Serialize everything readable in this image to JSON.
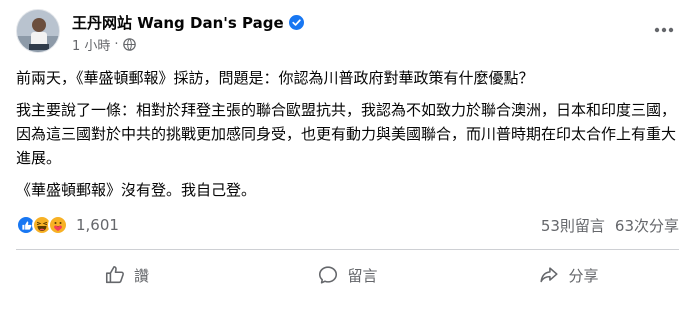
{
  "post": {
    "page_name": "王丹网站 Wang Dan's Page",
    "timestamp": "1 小時",
    "dot": "·",
    "paragraphs": [
      "前兩天，《華盛頓郵報》採訪，問題是：你認為川普政府對華政策有什麼優點？",
      "我主要說了一條：相對於拜登主張的聯合歐盟抗共，我認為不如致力於聯合澳洲，日本和印度三國，因為這三國對於中共的挑戰更加感同身受，也更有動力與美國聯合，而川普時期在印太合作上有重大進展。",
      "《華盛頓郵報》沒有登。我自己登。"
    ],
    "reaction_icons": [
      "like-icon",
      "haha-icon",
      "care-icon"
    ],
    "reaction_count": "1,601",
    "comments_count": "53則留言",
    "shares_count": "63次分享"
  },
  "actions": {
    "like_label": "讚",
    "comment_label": "留言",
    "share_label": "分享"
  },
  "colors": {
    "verified": "#1877f2",
    "secondary_text": "#65676b",
    "like": "#1877f2",
    "haha": "#f7b125"
  }
}
